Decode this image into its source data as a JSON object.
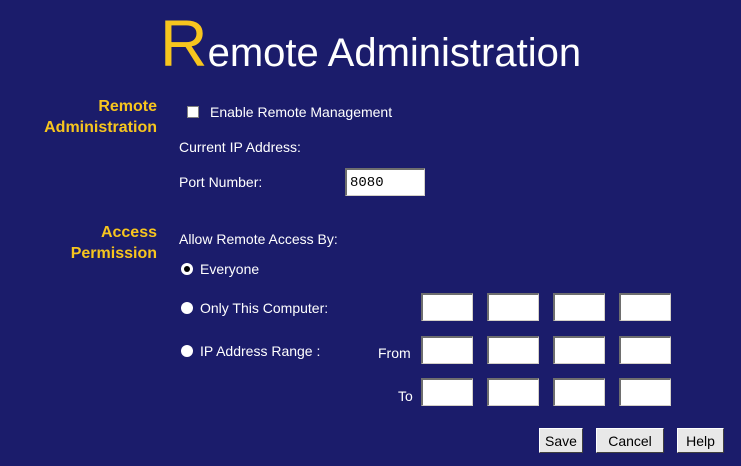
{
  "title": {
    "first_letter": "R",
    "rest": "emote Administration"
  },
  "remote_admin": {
    "section_label_line1": "Remote",
    "section_label_line2": "Administration",
    "enable_label": "Enable Remote Management",
    "enable_checked": false,
    "current_ip_label": "Current IP Address:",
    "port_label": "Port Number:",
    "port_value": "8080"
  },
  "access_permission": {
    "section_label_line1": "Access",
    "section_label_line2": "Permission",
    "allow_label": "Allow Remote Access By:",
    "options": [
      {
        "label": "Everyone",
        "selected": true
      },
      {
        "label": "Only This Computer:",
        "selected": false
      },
      {
        "label": "IP Address Range :",
        "selected": false
      }
    ],
    "from_label": "From",
    "to_label": "To"
  },
  "buttons": {
    "save": "Save",
    "cancel": "Cancel",
    "help": "Help"
  }
}
